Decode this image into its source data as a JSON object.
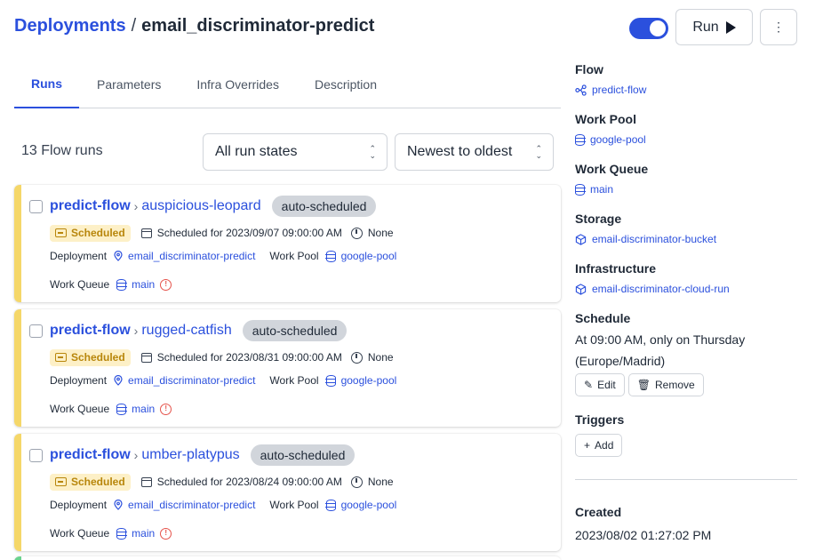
{
  "breadcrumb": {
    "parent": "Deployments",
    "separator": "/",
    "current": "email_discriminator-predict"
  },
  "header": {
    "run_label": "Run",
    "toggle_on": true
  },
  "tabs": [
    {
      "label": "Runs",
      "active": true
    },
    {
      "label": "Parameters",
      "active": false
    },
    {
      "label": "Infra Overrides",
      "active": false
    },
    {
      "label": "Description",
      "active": false
    }
  ],
  "runs": {
    "count_label": "13 Flow runs",
    "state_filter": "All run states",
    "sort": "Newest to oldest"
  },
  "labels": {
    "deployment": "Deployment",
    "work_pool": "Work Pool",
    "work_queue": "Work Queue"
  },
  "cards": [
    {
      "flow": "predict-flow",
      "run": "auspicious-leopard",
      "tag": "auto-scheduled",
      "state": "Scheduled",
      "scheduled": "Scheduled for 2023/09/07 09:00:00 AM",
      "duration": "None",
      "deployment": "email_discriminator-predict",
      "work_pool": "google-pool",
      "work_queue": "main"
    },
    {
      "flow": "predict-flow",
      "run": "rugged-catfish",
      "tag": "auto-scheduled",
      "state": "Scheduled",
      "scheduled": "Scheduled for 2023/08/31 09:00:00 AM",
      "duration": "None",
      "deployment": "email_discriminator-predict",
      "work_pool": "google-pool",
      "work_queue": "main"
    },
    {
      "flow": "predict-flow",
      "run": "umber-platypus",
      "tag": "auto-scheduled",
      "state": "Scheduled",
      "scheduled": "Scheduled for 2023/08/24 09:00:00 AM",
      "duration": "None",
      "deployment": "email_discriminator-predict",
      "work_pool": "google-pool",
      "work_queue": "main"
    }
  ],
  "sidebar": {
    "flow_label": "Flow",
    "flow_value": "predict-flow",
    "work_pool_label": "Work Pool",
    "work_pool_value": "google-pool",
    "work_queue_label": "Work Queue",
    "work_queue_value": "main",
    "storage_label": "Storage",
    "storage_value": "email-discriminator-bucket",
    "infrastructure_label": "Infrastructure",
    "infrastructure_value": "email-discriminator-cloud-run",
    "schedule_label": "Schedule",
    "schedule_text": "At 09:00 AM, only on Thursday (Europe/Madrid)",
    "edit_label": "Edit",
    "remove_label": "Remove",
    "triggers_label": "Triggers",
    "add_label": "Add",
    "created_label": "Created",
    "created_value": "2023/08/02 01:27:02 PM"
  },
  "colors": {
    "accent": "#2b50dd",
    "scheduled_stripe": "#f5d769",
    "scheduled_badge_bg": "#fdf0c7",
    "scheduled_badge_text": "#b8860b",
    "tag_bg": "#d1d5db",
    "warning": "#e5534b"
  }
}
